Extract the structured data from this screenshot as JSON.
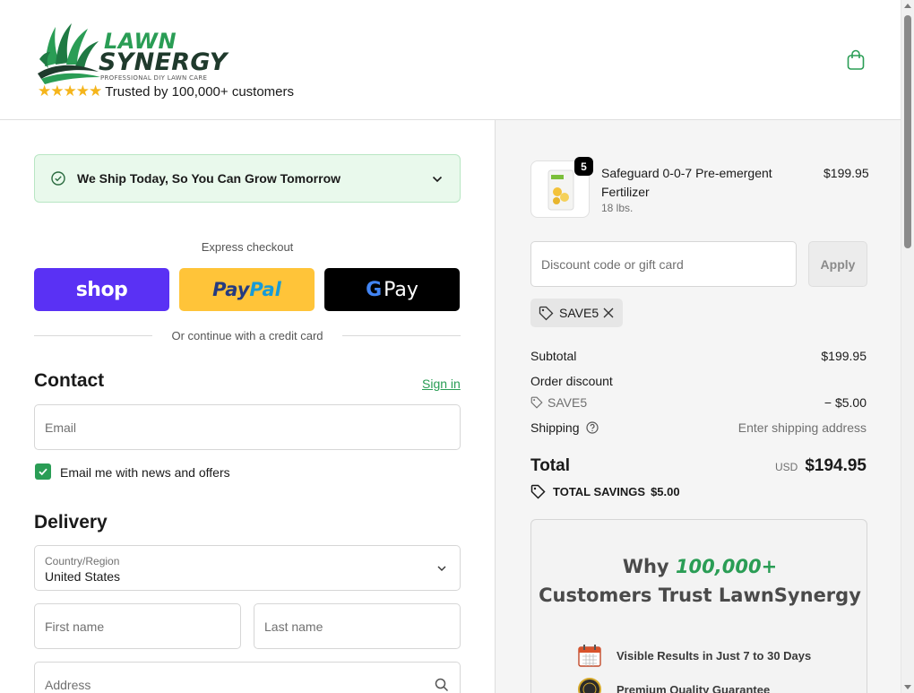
{
  "header": {
    "brand_line1": "LAWN",
    "brand_line2": "SYNERGY",
    "brand_tagline": "PROFESSIONAL DIY LAWN CARE",
    "stars": "★★★★★",
    "trust_text": "Trusted by 100,000+ customers",
    "cart_icon": "shopping-bag-icon"
  },
  "banner": {
    "text": "We Ship Today, So You Can Grow Tomorrow"
  },
  "express": {
    "label": "Express checkout",
    "shop_label": "shop",
    "paypal_part1": "Pay",
    "paypal_part2": "Pal",
    "gpay_g": "G",
    "gpay_label": "Pay",
    "divider_text": "Or continue with a credit card"
  },
  "contact": {
    "title": "Contact",
    "signin_label": "Sign in",
    "email_placeholder": "Email",
    "newsletter_label": "Email me with news and offers",
    "newsletter_checked": true
  },
  "delivery": {
    "title": "Delivery",
    "country_label": "Country/Region",
    "country_value": "United States",
    "first_name_placeholder": "First name",
    "last_name_placeholder": "Last name",
    "address_placeholder": "Address"
  },
  "order": {
    "product": {
      "quantity": "5",
      "name": "Safeguard 0-0-7 Pre-emergent Fertilizer",
      "variant": "18 lbs.",
      "price": "$199.95"
    },
    "discount_placeholder": "Discount code or gift card",
    "apply_label": "Apply",
    "applied_code": "SAVE5",
    "subtotal_label": "Subtotal",
    "subtotal_value": "$199.95",
    "order_discount_label": "Order discount",
    "discount_code": "SAVE5",
    "discount_value": "− $5.00",
    "shipping_label": "Shipping",
    "shipping_value": "Enter shipping address",
    "total_label": "Total",
    "currency": "USD",
    "total_value": "$194.95",
    "savings_label": "TOTAL SAVINGS",
    "savings_value": "$5.00"
  },
  "why": {
    "title_prefix": "Why",
    "title_highlight": "100,000+",
    "title_line2": "Customers Trust LawnSynergy",
    "items": [
      {
        "icon": "calendar-icon",
        "text": "Visible Results in Just 7 to 30 Days"
      },
      {
        "icon": "guarantee-badge-icon",
        "text": "Premium Quality Guarantee"
      }
    ]
  },
  "colors": {
    "brand_green": "#2a9d55",
    "shop_purple": "#5a31f4",
    "paypal_yellow": "#ffc439",
    "banner_bg": "#e9f9ec"
  }
}
